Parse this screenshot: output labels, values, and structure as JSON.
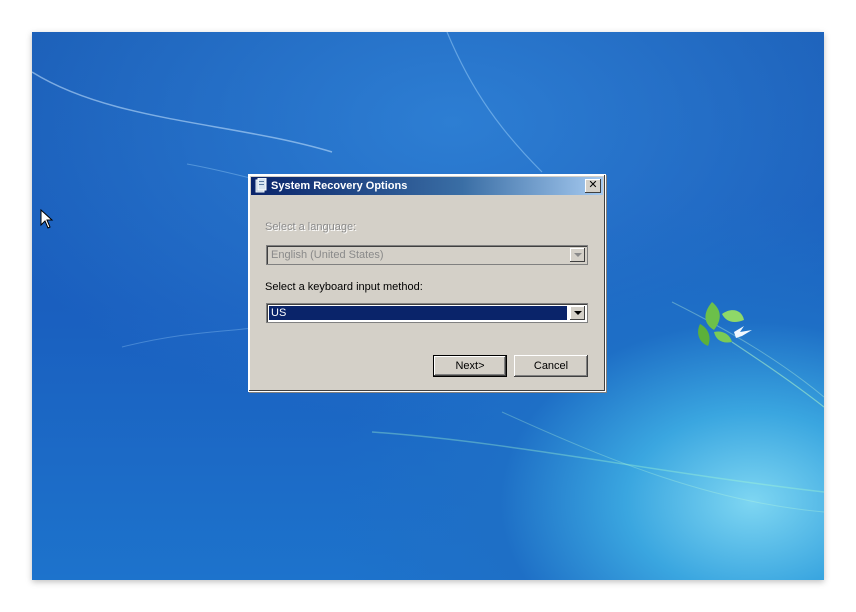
{
  "dialog": {
    "title": "System Recovery Options",
    "close_glyph": "✕",
    "language_label": "Select a language:",
    "language_value": "English (United States)",
    "keyboard_label": "Select a keyboard input method:",
    "keyboard_value": "US",
    "next_label": "Next>",
    "cancel_label": "Cancel"
  },
  "icons": {
    "title_icon": "recovery-options-icon",
    "cursor": "mouse-pointer-icon",
    "close": "close-icon",
    "dropdown": "chevron-down-icon"
  },
  "colors": {
    "titlebar_start": "#0a246a",
    "titlebar_end": "#a6caf0",
    "dialog_face": "#d4d0c8",
    "selection": "#0a246a",
    "desktop_blue": "#1b5db6"
  }
}
